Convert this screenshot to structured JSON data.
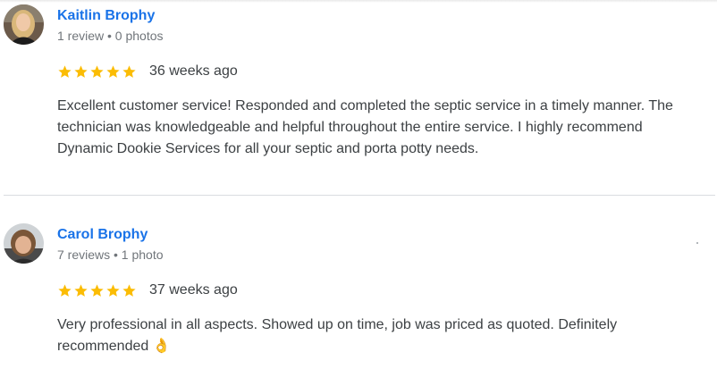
{
  "colors": {
    "name_link": "#1a73e8",
    "meta_text": "#70757a",
    "body_text": "#3c4043",
    "star": "#fbbc04",
    "divider": "#dadce0"
  },
  "reviews": [
    {
      "author": "Kaitlin Brophy",
      "meta": "1 review • 0 photos",
      "rating": 5,
      "time": "36 weeks ago",
      "text": "Excellent customer service! Responded and completed the septic service in a timely manner. The technician was knowledgeable and helpful throughout the entire service. I highly recommend Dynamic Dookie Services for all your septic and porta potty needs."
    },
    {
      "author": "Carol Brophy",
      "meta": "7 reviews • 1 photo",
      "rating": 5,
      "time": "37 weeks ago",
      "text": "Very professional in all aspects. Showed up on time, job was priced as quoted. Definitely recommended 👌"
    }
  ]
}
